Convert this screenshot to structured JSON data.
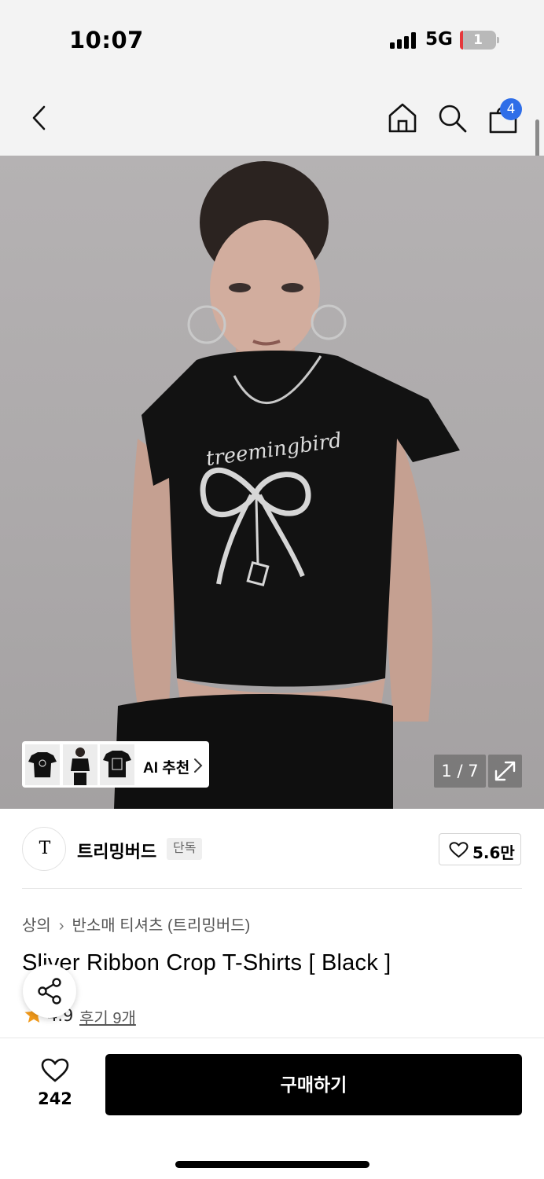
{
  "status_bar": {
    "time": "10:07",
    "network": "5G",
    "battery": "1"
  },
  "nav": {
    "cart_count": "4"
  },
  "icons": [
    "back-icon",
    "home-icon",
    "search-icon",
    "cart-icon",
    "expand-icon",
    "heart-icon",
    "share-icon",
    "star-icon",
    "chevron-right-icon"
  ],
  "gallery": {
    "ai_label": "AI 추천",
    "counter": "1 / 7"
  },
  "brand": {
    "logo_text": "T",
    "name": "트리밍버드",
    "badge": "단독",
    "likes": "5.6만"
  },
  "breadcrumb": {
    "category": "상의",
    "subcategory": "반소매 티셔츠 (트리밍버드)"
  },
  "product": {
    "title": "Sliver Ribbon Crop T-Shirts [ Black ]",
    "rating": "4.9",
    "reviews": "후기 9개"
  },
  "bottom_bar": {
    "wish_count": "242",
    "buy_label": "구매하기"
  },
  "colors": {
    "accent_blue": "#2f6ee8",
    "star": "#f29a1a",
    "button": "#000000"
  }
}
